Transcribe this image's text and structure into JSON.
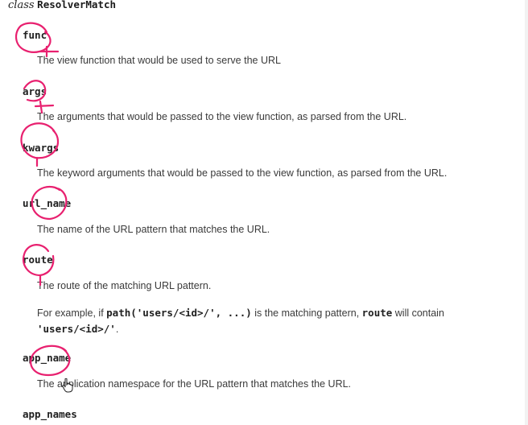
{
  "class_heading": {
    "keyword": "class",
    "name": "ResolverMatch"
  },
  "attributes": [
    {
      "name": "func",
      "description": "The view function that would be used to serve the URL"
    },
    {
      "name": "args",
      "description": "The arguments that would be passed to the view function, as parsed from the URL."
    },
    {
      "name": "kwargs",
      "description": "The keyword arguments that would be passed to the view function, as parsed from the URL."
    },
    {
      "name": "url_name",
      "description": "The name of the URL pattern that matches the URL."
    },
    {
      "name": "route",
      "description": "The route of the matching URL pattern."
    },
    {
      "name": "app_name",
      "description": "The application namespace for the URL pattern that matches the URL."
    },
    {
      "name": "app_names",
      "description": ""
    }
  ],
  "route_example": {
    "text_1": "For example, if ",
    "code_1": "path('users/<id>/', ...)",
    "text_2": " is the matching pattern, ",
    "code_2": "route",
    "text_3": " will contain",
    "code_3": "'users/<id>/'",
    "text_4": "."
  },
  "colors": {
    "annotation": "#e8206f",
    "text": "#3a3a3a",
    "code": "#1f1f1f"
  },
  "icons": {
    "cursor": "hand-pointer-icon"
  }
}
